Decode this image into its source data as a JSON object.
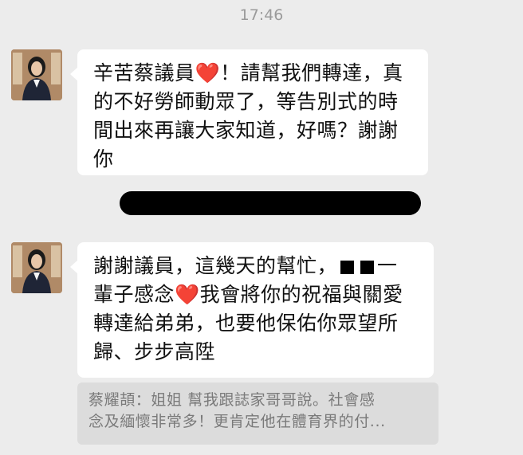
{
  "timestamp": "17:46",
  "messages": [
    {
      "lines": [
        {
          "before": "辛苦蔡議員",
          "heart": "❤️",
          "after": "！請幫我們轉達，真"
        },
        "的不好勞師動眾了，等告別式的時",
        "間出來再讓大家知道，好嗎？謝謝",
        "你"
      ]
    },
    {
      "lines": [
        {
          "before": "謝謝議員，這幾天的幫忙，",
          "after": "一"
        },
        {
          "before": "輩子感念",
          "heart": "❤️",
          "after": "我會將你的祝福與關愛"
        },
        "轉達給弟弟，也要他保佑你眾望所",
        "歸、步步高陞"
      ]
    }
  ],
  "reply_quote": {
    "line1": "蔡耀頡：姐姐 幫我跟誌家哥哥說。社會感",
    "line2": "念及緬懷非常多！更肯定他在體育界的付..."
  },
  "colors": {
    "bubble": "#ffffff",
    "background": "#ececec",
    "heart": "#e0281e",
    "quote_bg": "#dcdcdc"
  }
}
